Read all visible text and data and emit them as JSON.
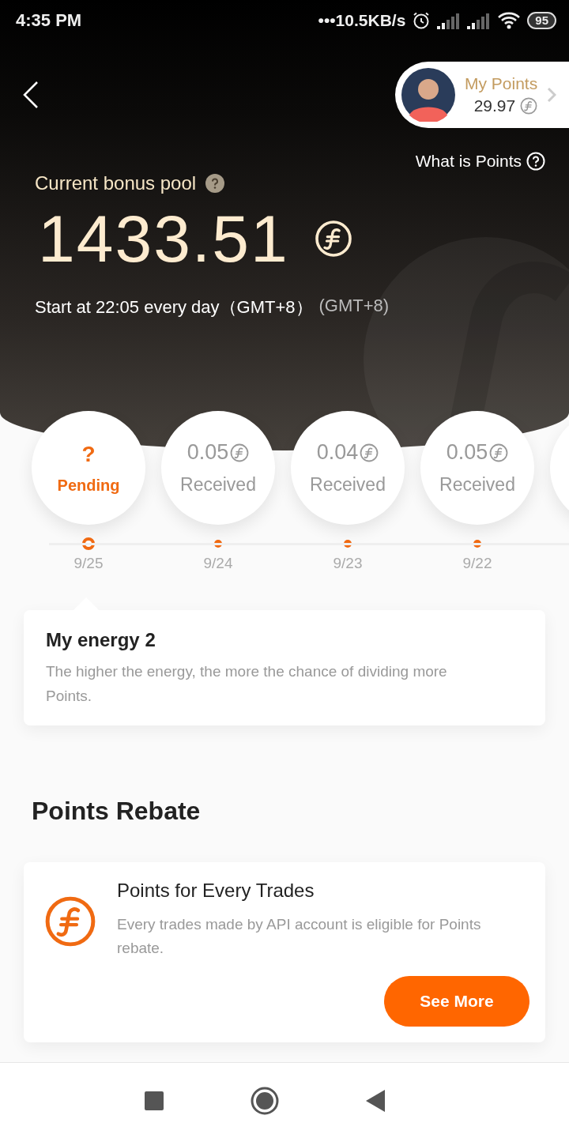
{
  "status_bar": {
    "time": "4:35 PM",
    "network_speed": "•••10.5KB/s",
    "battery": "95"
  },
  "header": {
    "my_points": {
      "label": "My Points",
      "value": "29.97"
    },
    "help_link": "What is Points",
    "pool_label": "Current bonus pool",
    "pool_amount": "1433.51",
    "schedule": "Start at 22:05 every day（GMT+8）",
    "timezone": "(GMT+8)"
  },
  "days": [
    {
      "kind": "pending",
      "amount": "?",
      "status": "Pending",
      "date": "9/25",
      "selected": true
    },
    {
      "kind": "received",
      "amount": "0.05",
      "status": "Received",
      "date": "9/24",
      "selected": false
    },
    {
      "kind": "received",
      "amount": "0.04",
      "status": "Received",
      "date": "9/23",
      "selected": false
    },
    {
      "kind": "received",
      "amount": "0.05",
      "status": "Received",
      "date": "9/22",
      "selected": false
    }
  ],
  "energy": {
    "title": "My energy 2",
    "description": "The higher the energy, the more the chance of dividing more Points."
  },
  "rebate": {
    "heading": "Points Rebate",
    "card": {
      "title": "Points for Every Trades",
      "description": "Every trades made by API account is eligible for Points rebate.",
      "button": "See More"
    }
  }
}
